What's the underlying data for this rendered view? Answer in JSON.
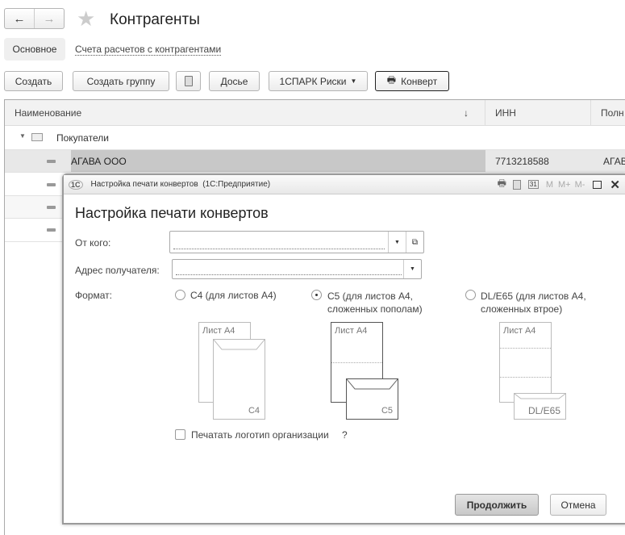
{
  "header": {
    "title": "Контрагенты",
    "back_icon": "arrow-left",
    "forward_icon": "arrow-right",
    "favorite_icon": "star"
  },
  "tabs": [
    {
      "label": "Основное"
    },
    {
      "label": "Счета расчетов с контрагентами"
    }
  ],
  "toolbar": {
    "create": "Создать",
    "create_group": "Создать группу",
    "dossier": "Досье",
    "spark": "1СПАРК Риски",
    "envelope": "Конверт"
  },
  "table": {
    "columns": [
      "Наименование",
      "ИНН",
      "Полн"
    ],
    "sort_indicator": "↓",
    "group": "Покупатели",
    "rows": [
      {
        "name": "АГАВА ООО",
        "inn": "7713218588",
        "full": "АГАВ"
      }
    ]
  },
  "dialog": {
    "window_title": "Настройка печати конвертов  (1С:Предприятие)",
    "title_buttons": [
      "M",
      "M+",
      "M-"
    ],
    "heading": "Настройка печати конвертов",
    "from_label": "От кого:",
    "from_value": "",
    "address_label": "Адрес получателя:",
    "address_value": "",
    "format_label": "Формат:",
    "formats": [
      {
        "label": "C4 (для листов А4)",
        "line2": "",
        "selected": false,
        "sheet": "Лист А4",
        "env": "C4"
      },
      {
        "label": "C5 (для листов А4,",
        "line2": "сложенных пополам)",
        "selected": true,
        "sheet": "Лист А4",
        "env": "C5"
      },
      {
        "label": "DL/E65 (для листов А4,",
        "line2": "сложенных втрое)",
        "selected": false,
        "sheet": "Лист А4",
        "env": "DL/E65"
      }
    ],
    "logo_checkbox": "Печатать логотип организации",
    "logo_checked": false,
    "help": "?",
    "continue": "Продолжить",
    "cancel": "Отмена"
  }
}
